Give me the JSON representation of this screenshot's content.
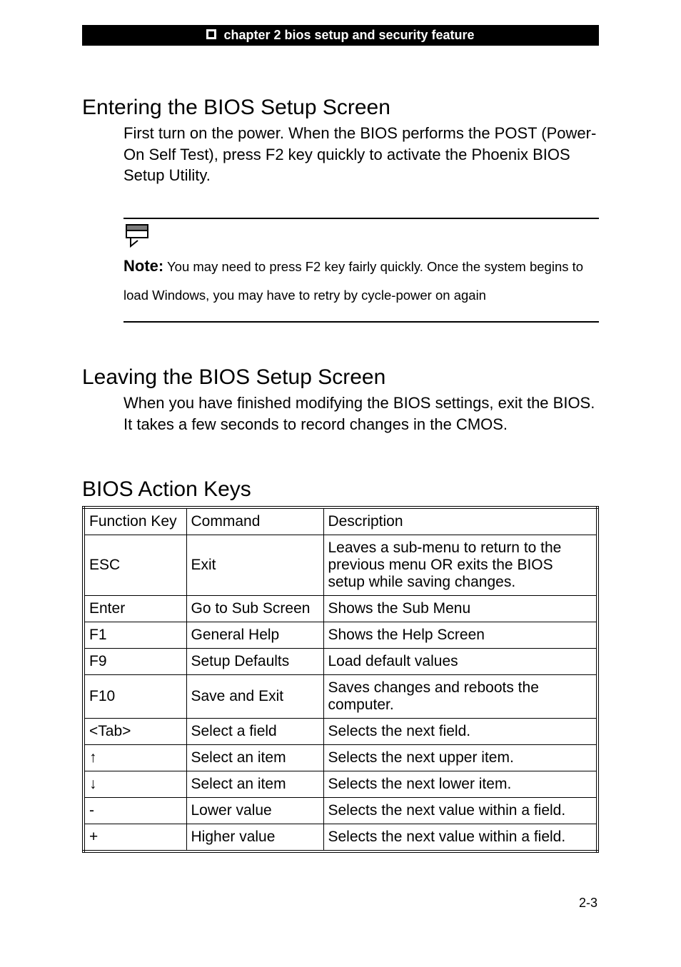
{
  "header": {
    "chapter_label": "chapter 2 bios setup and security feature"
  },
  "section1": {
    "title": "Entering the BIOS Setup Screen",
    "body": "First turn on the power. When the BIOS performs the POST (Power-On Self Test), press F2 key quickly to activate the Phoenix BIOS Setup Utility."
  },
  "note": {
    "label": "Note:",
    "text": " You may need to press F2 key fairly quickly. Once the system begins to load Windows, you may have to retry by cycle-power on again"
  },
  "section2": {
    "title": "Leaving the BIOS Setup Screen",
    "body": "When you have finished modifying the BIOS settings, exit the BIOS. It takes a few seconds to record changes in the CMOS."
  },
  "section3": {
    "title": "BIOS Action Keys"
  },
  "table": {
    "headers": {
      "col1": "Function Key",
      "col2": "Command",
      "col3": "Description"
    },
    "rows": [
      {
        "key": "ESC",
        "cmd": "Exit",
        "desc": "Leaves a sub-menu to return to the previous menu OR exits the BIOS setup while saving changes."
      },
      {
        "key": "Enter",
        "cmd": "Go to Sub Screen",
        "desc": "Shows the Sub Menu"
      },
      {
        "key": "F1",
        "cmd": "General Help",
        "desc": "Shows the Help Screen"
      },
      {
        "key": "F9",
        "cmd": "Setup Defaults",
        "desc": "Load default values"
      },
      {
        "key": "F10",
        "cmd": "Save and Exit",
        "desc": "Saves changes and reboots the computer."
      },
      {
        "key": "<Tab>",
        "cmd": "Select a field",
        "desc": "Selects the next field."
      },
      {
        "key": "↑",
        "cmd": "Select an item",
        "desc": "Selects the next upper item."
      },
      {
        "key": "↓",
        "cmd": "Select an item",
        "desc": "Selects the next lower item."
      },
      {
        "key": "-",
        "cmd": "Lower value",
        "desc": "Selects the next value within a field."
      },
      {
        "key": "+",
        "cmd": "Higher value",
        "desc": "Selects the next value within a field."
      }
    ]
  },
  "page_number": "2-3"
}
